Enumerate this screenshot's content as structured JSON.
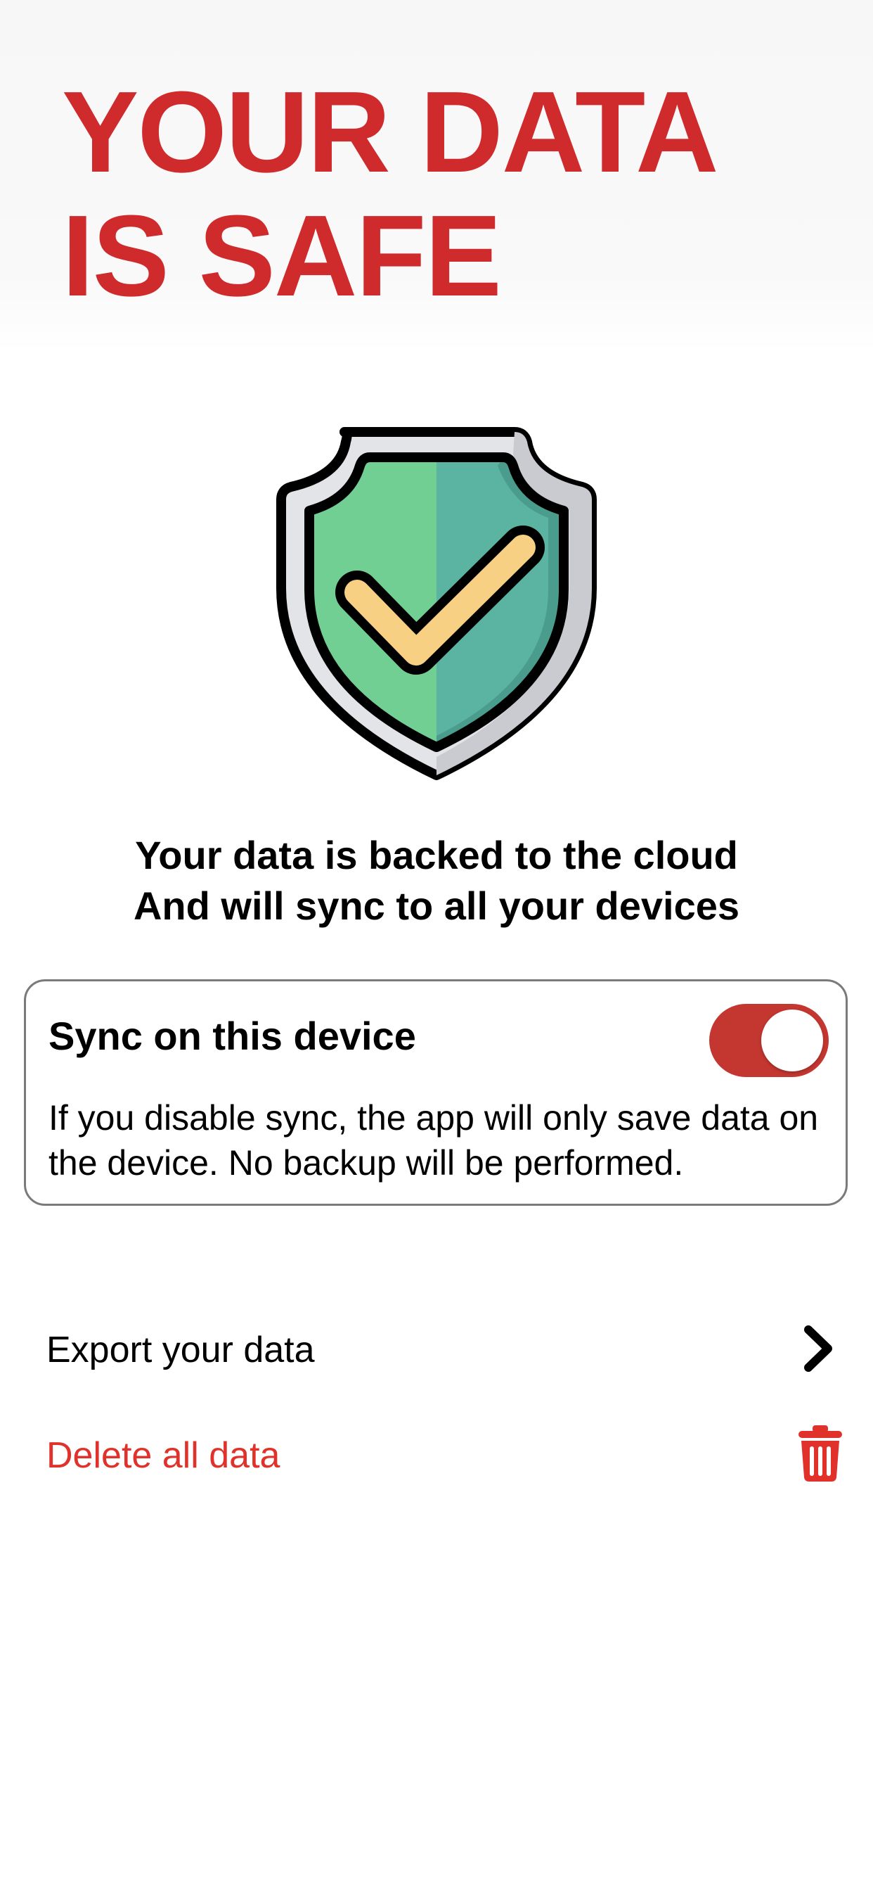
{
  "header": {
    "title_line1": "YOUR DATA",
    "title_line2": "IS SAFE"
  },
  "hero": {
    "icon": "shield-check-icon"
  },
  "message": {
    "line1": "Your data is backed to the cloud",
    "line2": "And will sync to all your devices"
  },
  "sync": {
    "title": "Sync on this device",
    "description": "If you disable sync, the app will only save data on the device. No backup will be performed.",
    "enabled": true
  },
  "actions": {
    "export_label": "Export your data",
    "export_icon": "chevron-right-icon",
    "delete_label": "Delete all data",
    "delete_icon": "trash-icon"
  },
  "colors": {
    "accent": "#cf2a2c",
    "toggle_on": "#c33730",
    "destructive": "#e0312a",
    "shield_green_light": "#72cf94",
    "shield_green_dark": "#5bb3a2",
    "check_yellow": "#f7d084"
  }
}
